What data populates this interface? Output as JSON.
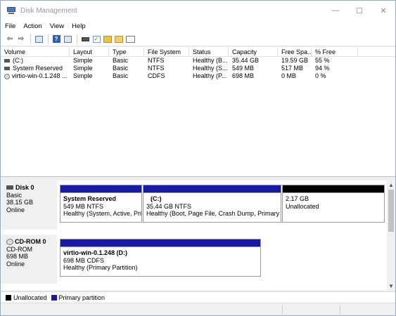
{
  "window": {
    "title": "Disk Management",
    "controls": {
      "minimize": "—",
      "maximize": "☐",
      "close": "✕"
    }
  },
  "menu": [
    "File",
    "Action",
    "View",
    "Help"
  ],
  "volumes_table": {
    "columns": [
      "Volume",
      "Layout",
      "Type",
      "File System",
      "Status",
      "Capacity",
      "Free Spa...",
      "% Free"
    ],
    "rows": [
      {
        "volume": "(C:)",
        "layout": "Simple",
        "type": "Basic",
        "fs": "NTFS",
        "status": "Healthy (B...",
        "capacity": "35.44 GB",
        "free": "19.59 GB",
        "pct": "55 %"
      },
      {
        "volume": "System Reserved",
        "layout": "Simple",
        "type": "Basic",
        "fs": "NTFS",
        "status": "Healthy (S...",
        "capacity": "549 MB",
        "free": "517 MB",
        "pct": "94 %"
      },
      {
        "volume": "virtio-win-0.1.248 ...",
        "layout": "Simple",
        "type": "Basic",
        "fs": "CDFS",
        "status": "Healthy (P...",
        "capacity": "698 MB",
        "free": "0 MB",
        "pct": "0 %"
      }
    ]
  },
  "disks": [
    {
      "name": "Disk 0",
      "type": "Basic",
      "size": "38.15 GB",
      "state": "Online",
      "partitions": [
        {
          "name": "System Reserved",
          "detail": "549 MB NTFS",
          "status": "Healthy (System, Active, Pri"
        },
        {
          "name": "(C:)",
          "detail": "35.44 GB NTFS",
          "status": "Healthy (Boot, Page File, Crash Dump, Primary F"
        },
        {
          "name": "",
          "detail": "2.17 GB",
          "status": "Unallocated"
        }
      ]
    },
    {
      "name": "CD-ROM 0",
      "type": "CD-ROM",
      "size": "698 MB",
      "state": "Online",
      "partitions": [
        {
          "name": "virtio-win-0.1.248  (D:)",
          "detail": "698 MB CDFS",
          "status": "Healthy (Primary Partition)"
        }
      ]
    }
  ],
  "legend": [
    {
      "label": "Unallocated",
      "color": "#000000"
    },
    {
      "label": "Primary partition",
      "color": "#1a1aa0"
    }
  ],
  "colors": {
    "primary_partition": "#1a1aa0",
    "unallocated": "#000000"
  }
}
